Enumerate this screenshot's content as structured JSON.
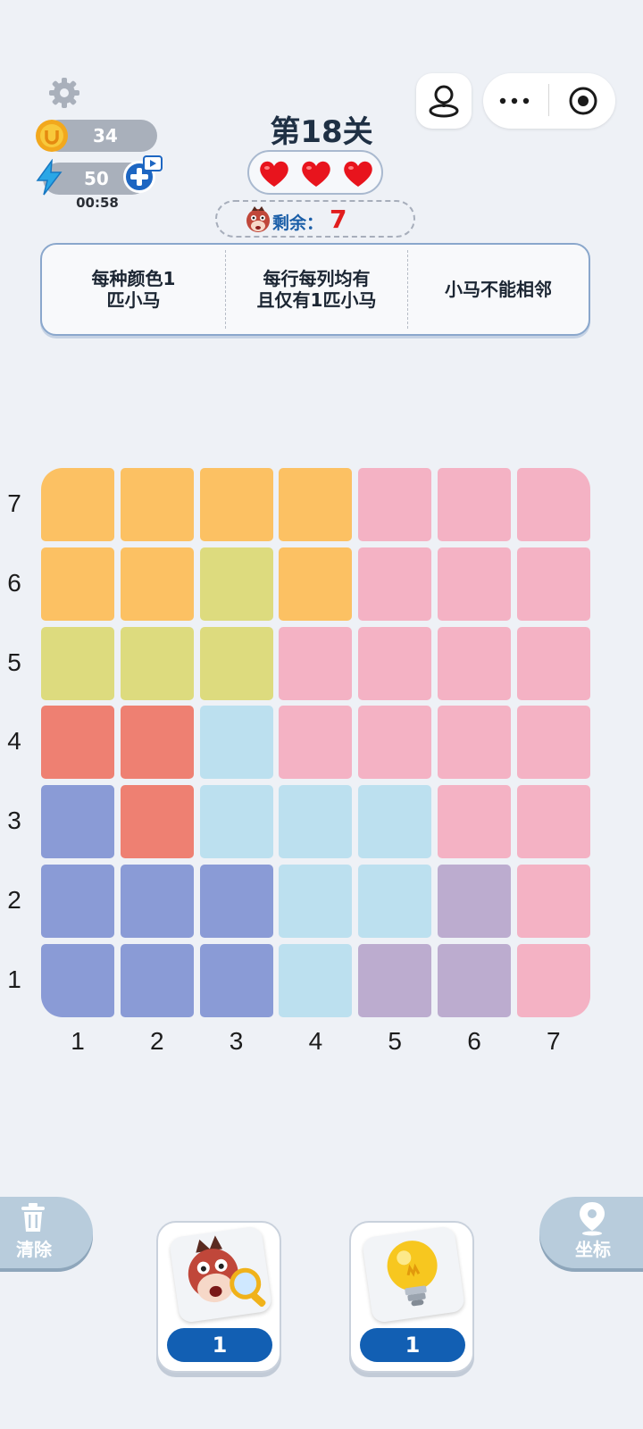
{
  "header": {
    "level_title": "第18关",
    "lives": 3,
    "remaining_label": "剩余：",
    "remaining_count": "7"
  },
  "stats": {
    "coins": "34",
    "energy": "50",
    "timer": "00:58"
  },
  "rules": [
    "每种颜色1\n匹小马",
    "每行每列均有\n且仅有1匹小马",
    "小马不能相邻"
  ],
  "grid": {
    "size": 7,
    "colors": {
      "orange": "#fcc163",
      "yellow": "#dddb7e",
      "pink": "#f4b2c4",
      "red": "#ee8072",
      "blue": "#bce0ef",
      "indigo": "#8a9bd6",
      "purple": "#bcaccf"
    },
    "rows": [
      {
        "label": "7",
        "cells": [
          "orange",
          "orange",
          "orange",
          "orange",
          "pink",
          "pink",
          "pink"
        ]
      },
      {
        "label": "6",
        "cells": [
          "orange",
          "orange",
          "yellow",
          "orange",
          "pink",
          "pink",
          "pink"
        ]
      },
      {
        "label": "5",
        "cells": [
          "yellow",
          "yellow",
          "yellow",
          "pink",
          "pink",
          "pink",
          "pink"
        ]
      },
      {
        "label": "4",
        "cells": [
          "red",
          "red",
          "blue",
          "pink",
          "pink",
          "pink",
          "pink"
        ]
      },
      {
        "label": "3",
        "cells": [
          "indigo",
          "red",
          "blue",
          "blue",
          "blue",
          "pink",
          "pink"
        ]
      },
      {
        "label": "2",
        "cells": [
          "indigo",
          "indigo",
          "indigo",
          "blue",
          "blue",
          "purple",
          "pink"
        ]
      },
      {
        "label": "1",
        "cells": [
          "indigo",
          "indigo",
          "indigo",
          "blue",
          "purple",
          "purple",
          "pink"
        ]
      }
    ],
    "column_labels": [
      "1",
      "2",
      "3",
      "4",
      "5",
      "6",
      "7"
    ]
  },
  "controls": {
    "clear_label": "清除",
    "coord_label": "坐标",
    "hint_horse_count": "1",
    "hint_bulb_count": "1"
  }
}
